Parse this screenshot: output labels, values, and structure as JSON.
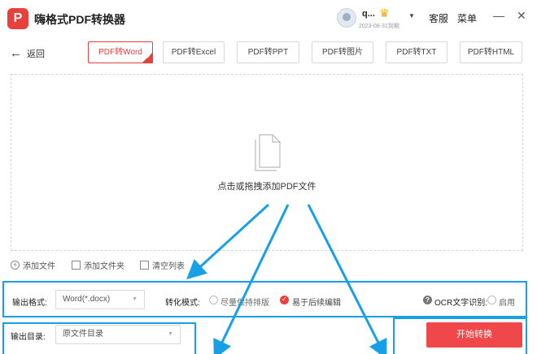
{
  "app": {
    "title": "嗨格式PDF转换器",
    "logo_letter": "P",
    "username": "q...",
    "vip_expiry": "2023-08-31到期",
    "menu": {
      "service": "客服",
      "menu": "菜单"
    },
    "window_buttons": {
      "minimize": "—",
      "close": "✕"
    }
  },
  "toolbar": {
    "back_label": "返回",
    "back_arrow": "←",
    "tabs": [
      {
        "label": "PDF转Word",
        "active": true
      },
      {
        "label": "PDF转Excel",
        "active": false
      },
      {
        "label": "PDF转PPT",
        "active": false
      },
      {
        "label": "PDF转图片",
        "active": false
      },
      {
        "label": "PDF转TXT",
        "active": false
      },
      {
        "label": "PDF转HTML",
        "active": false
      }
    ]
  },
  "dropzone": {
    "text": "点击或拖拽添加PDF文件"
  },
  "actions": {
    "add_file": "添加文件",
    "add_folder": "添加文件夹",
    "clear_list": "清空列表"
  },
  "options": {
    "format_label": "输出格式:",
    "format_value": "Word(*.docx)",
    "mode_label": "转化模式:",
    "mode_options": [
      {
        "label": "尽量保持排版",
        "checked": false
      },
      {
        "label": "易于后续编辑",
        "checked": true
      }
    ],
    "ocr_label": "OCR文字识别:",
    "ocr_option": "启用",
    "ocr_enabled": false
  },
  "output": {
    "dir_label": "输出目录:",
    "dir_value": "原文件目录",
    "start_button": "开始转换"
  },
  "colors": {
    "accent": "#e8403c",
    "annotation": "#18a0e6"
  }
}
